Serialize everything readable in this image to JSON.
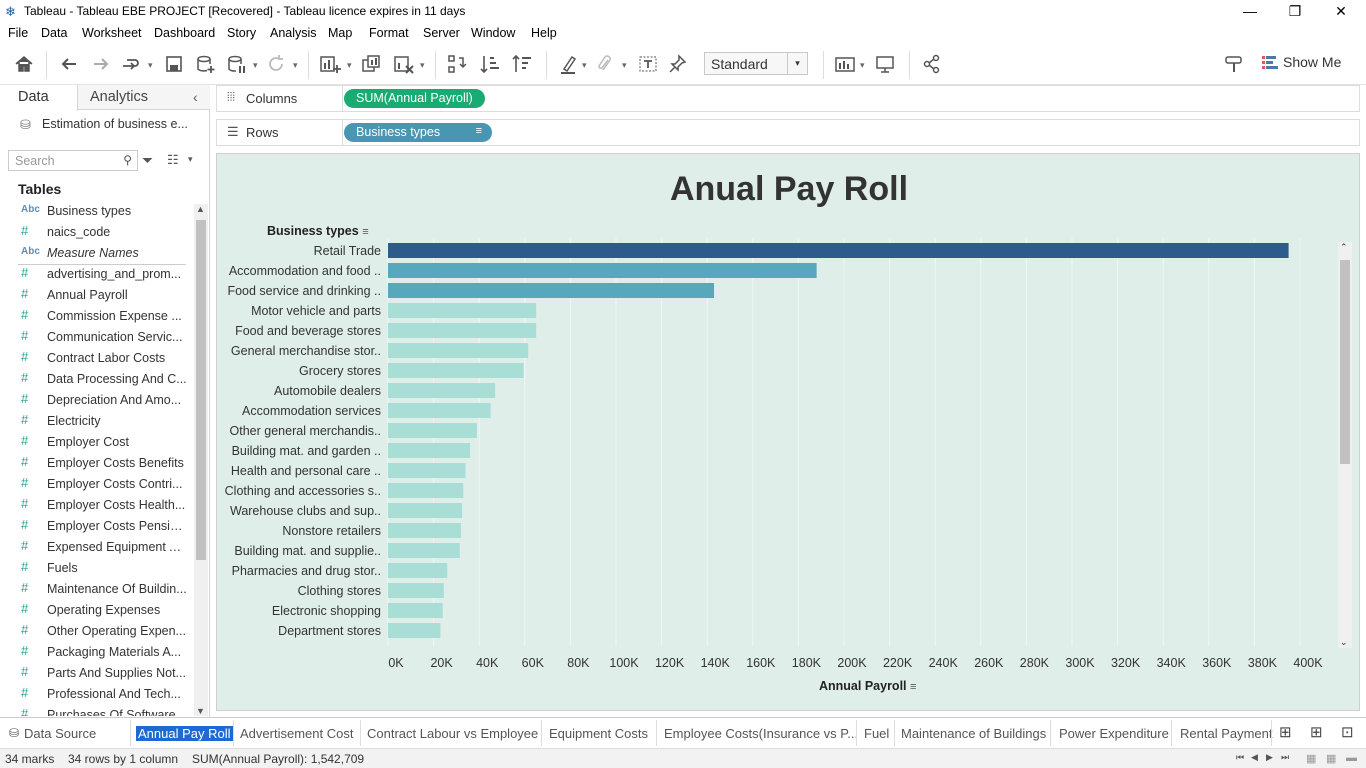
{
  "window": {
    "title": "Tableau - Tableau EBE PROJECT [Recovered] - Tableau licence expires in 11 days",
    "minimize": "—",
    "restore": "❐",
    "close": "✕"
  },
  "menu": [
    "File",
    "Data",
    "Worksheet",
    "Dashboard",
    "Story",
    "Analysis",
    "Map",
    "Format",
    "Server",
    "Window",
    "Help"
  ],
  "toolbar": {
    "fit_mode": "Standard",
    "show_me": "Show Me"
  },
  "left_pane": {
    "tabs": [
      "Data",
      "Analytics"
    ],
    "data_source": "Estimation of business e...",
    "search_placeholder": "Search",
    "tables_header": "Tables",
    "fields": [
      {
        "type": "Abc",
        "name": "Business types"
      },
      {
        "type": "#",
        "name": "naics_code"
      },
      {
        "type": "Abc",
        "name": "Measure Names",
        "italic": true
      },
      {
        "type": "#",
        "name": "advertising_and_prom..."
      },
      {
        "type": "#",
        "name": "Annual Payroll"
      },
      {
        "type": "#",
        "name": "Commission Expense ..."
      },
      {
        "type": "#",
        "name": "Communication Servic..."
      },
      {
        "type": "#",
        "name": "Contract Labor Costs"
      },
      {
        "type": "#",
        "name": "Data Processing And C..."
      },
      {
        "type": "#",
        "name": "Depreciation And Amo..."
      },
      {
        "type": "#",
        "name": "Electricity"
      },
      {
        "type": "#",
        "name": "Employer Cost"
      },
      {
        "type": "#",
        "name": "Employer Costs Benefits"
      },
      {
        "type": "#",
        "name": "Employer Costs Contri..."
      },
      {
        "type": "#",
        "name": "Employer Costs Health..."
      },
      {
        "type": "#",
        "name": "Employer Costs Pensio..."
      },
      {
        "type": "#",
        "name": "Expensed Equipment A..."
      },
      {
        "type": "#",
        "name": "Fuels"
      },
      {
        "type": "#",
        "name": "Maintenance Of Buildin..."
      },
      {
        "type": "#",
        "name": "Operating Expenses"
      },
      {
        "type": "#",
        "name": "Other Operating Expen..."
      },
      {
        "type": "#",
        "name": "Packaging Materials A..."
      },
      {
        "type": "#",
        "name": "Parts And Supplies Not..."
      },
      {
        "type": "#",
        "name": "Professional And Tech..."
      },
      {
        "type": "#",
        "name": "Purchases Of Software..."
      }
    ]
  },
  "shelves": {
    "columns_label": "Columns",
    "rows_label": "Rows",
    "columns_pill": "SUM(Annual Payroll)",
    "rows_pill": "Business types"
  },
  "chart_data": {
    "type": "bar",
    "orientation": "horizontal",
    "title": "Anual Pay Roll",
    "category_header": "Business types",
    "xlabel": "Annual Payroll",
    "xlim": [
      0,
      400000
    ],
    "x_ticks": [
      "0K",
      "20K",
      "40K",
      "60K",
      "80K",
      "100K",
      "120K",
      "140K",
      "160K",
      "180K",
      "200K",
      "220K",
      "240K",
      "260K",
      "280K",
      "300K",
      "320K",
      "340K",
      "360K",
      "380K",
      "400K"
    ],
    "categories": [
      "Retail Trade",
      "Accommodation and food ..",
      "Food service and drinking ..",
      "Motor vehicle and parts",
      "Food and beverage stores",
      "General merchandise stor..",
      "Grocery stores",
      "Automobile dealers",
      "Accommodation services",
      "Other general merchandis..",
      "Building mat. and garden ..",
      "Health and personal care ..",
      "Clothing and accessories s..",
      "Warehouse clubs and sup..",
      "Nonstore retailers",
      "Building mat. and supplie..",
      "Pharmacies and drug stor..",
      "Clothing stores",
      "Electronic shopping",
      "Department stores"
    ],
    "values": [
      395000,
      188000,
      143000,
      65000,
      65000,
      61500,
      59500,
      47000,
      45000,
      39000,
      36000,
      34000,
      33000,
      32500,
      32000,
      31500,
      26000,
      24500,
      24000,
      23000
    ],
    "colors": {
      "top": "#2e5c8a",
      "mid": "#57a8bd",
      "low": "#a9ded7",
      "background": "#e0eeea",
      "grid": "#eef6f4"
    }
  },
  "sheet_tabs": [
    "Data Source",
    "Annual Pay Roll",
    "Advertisement Cost",
    "Contract Labour vs Employee",
    "Equipment  Costs",
    "Employee Costs(Insurance vs P...",
    "Fuel",
    "Maintenance of Buildings",
    "Power Expenditure",
    "Rental Payment"
  ],
  "status": {
    "marks": "34 marks",
    "rows_cols": "34 rows  by 1 column",
    "sum": "SUM(Annual Payroll): 1,542,709"
  }
}
